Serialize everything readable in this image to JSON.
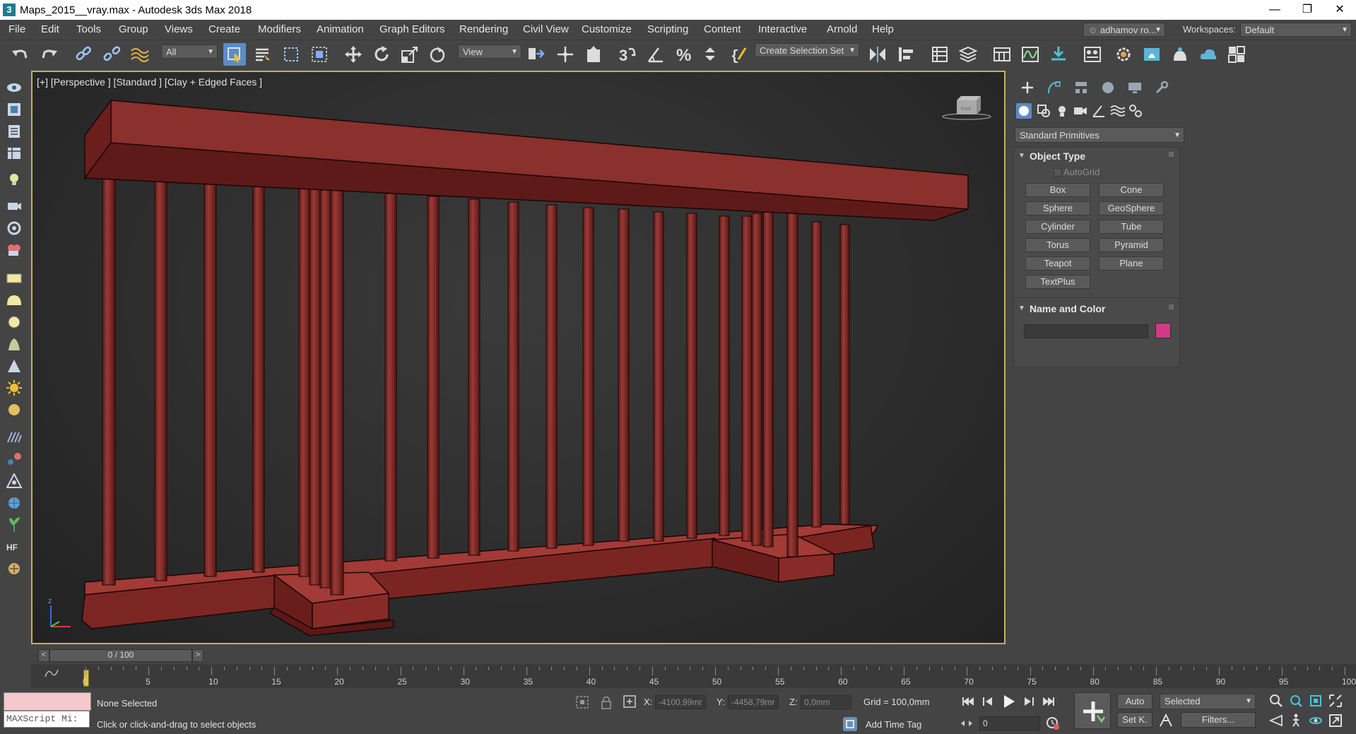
{
  "window": {
    "title": "Maps_2015__vray.max - Autodesk 3ds Max 2018",
    "app_icon": "3",
    "minimize": "—",
    "restore": "❐",
    "close": "✕"
  },
  "menu": [
    "File",
    "Edit",
    "Tools",
    "Group",
    "Views",
    "Create",
    "Modifiers",
    "Animation",
    "Graph Editors",
    "Rendering",
    "Civil View",
    "Customize",
    "Scripting",
    "Content",
    "Interactive",
    "Arnold",
    "Help"
  ],
  "account": {
    "user": "adhamov ro...",
    "workspaces_label": "Workspaces:",
    "workspace": "Default"
  },
  "toolbar": {
    "selection_filter": "All",
    "ref_coord": "View",
    "selection_set": "Create Selection Set"
  },
  "viewport": {
    "label": "[+] [Perspective ] [Standard ] [Clay + Edged Faces ]",
    "object_color": "#8a2e2b",
    "border_color": "#c6b15a"
  },
  "command_panel": {
    "category": "Standard Primitives",
    "object_type_title": "Object Type",
    "autogrid": "AutoGrid",
    "buttons": [
      "Box",
      "Cone",
      "Sphere",
      "GeoSphere",
      "Cylinder",
      "Tube",
      "Torus",
      "Pyramid",
      "Teapot",
      "Plane",
      "TextPlus"
    ],
    "name_color_title": "Name and Color",
    "name_value": "",
    "color_swatch": "#d13a87"
  },
  "timeline": {
    "frame_display": "0 / 100",
    "prev": "<",
    "next": ">",
    "ticks": [
      0,
      5,
      10,
      15,
      20,
      25,
      30,
      35,
      40,
      45,
      50,
      55,
      60,
      65,
      70,
      75,
      80,
      85,
      90,
      95,
      100
    ]
  },
  "status": {
    "maxscript": "MAXScript Mi:",
    "selection": "None Selected",
    "prompt": "Click or click-and-drag to select objects",
    "x_label": "X:",
    "x_value": "-4100,99mr",
    "y_label": "Y:",
    "y_value": "-4458,79mr",
    "z_label": "Z:",
    "z_value": "0,0mm",
    "grid": "Grid = 100,0mm",
    "add_time_tag": "Add Time Tag",
    "auto": "Auto",
    "set_key": "Set K.",
    "key_filter": "Selected",
    "filters": "Filters...",
    "frame": "0"
  }
}
